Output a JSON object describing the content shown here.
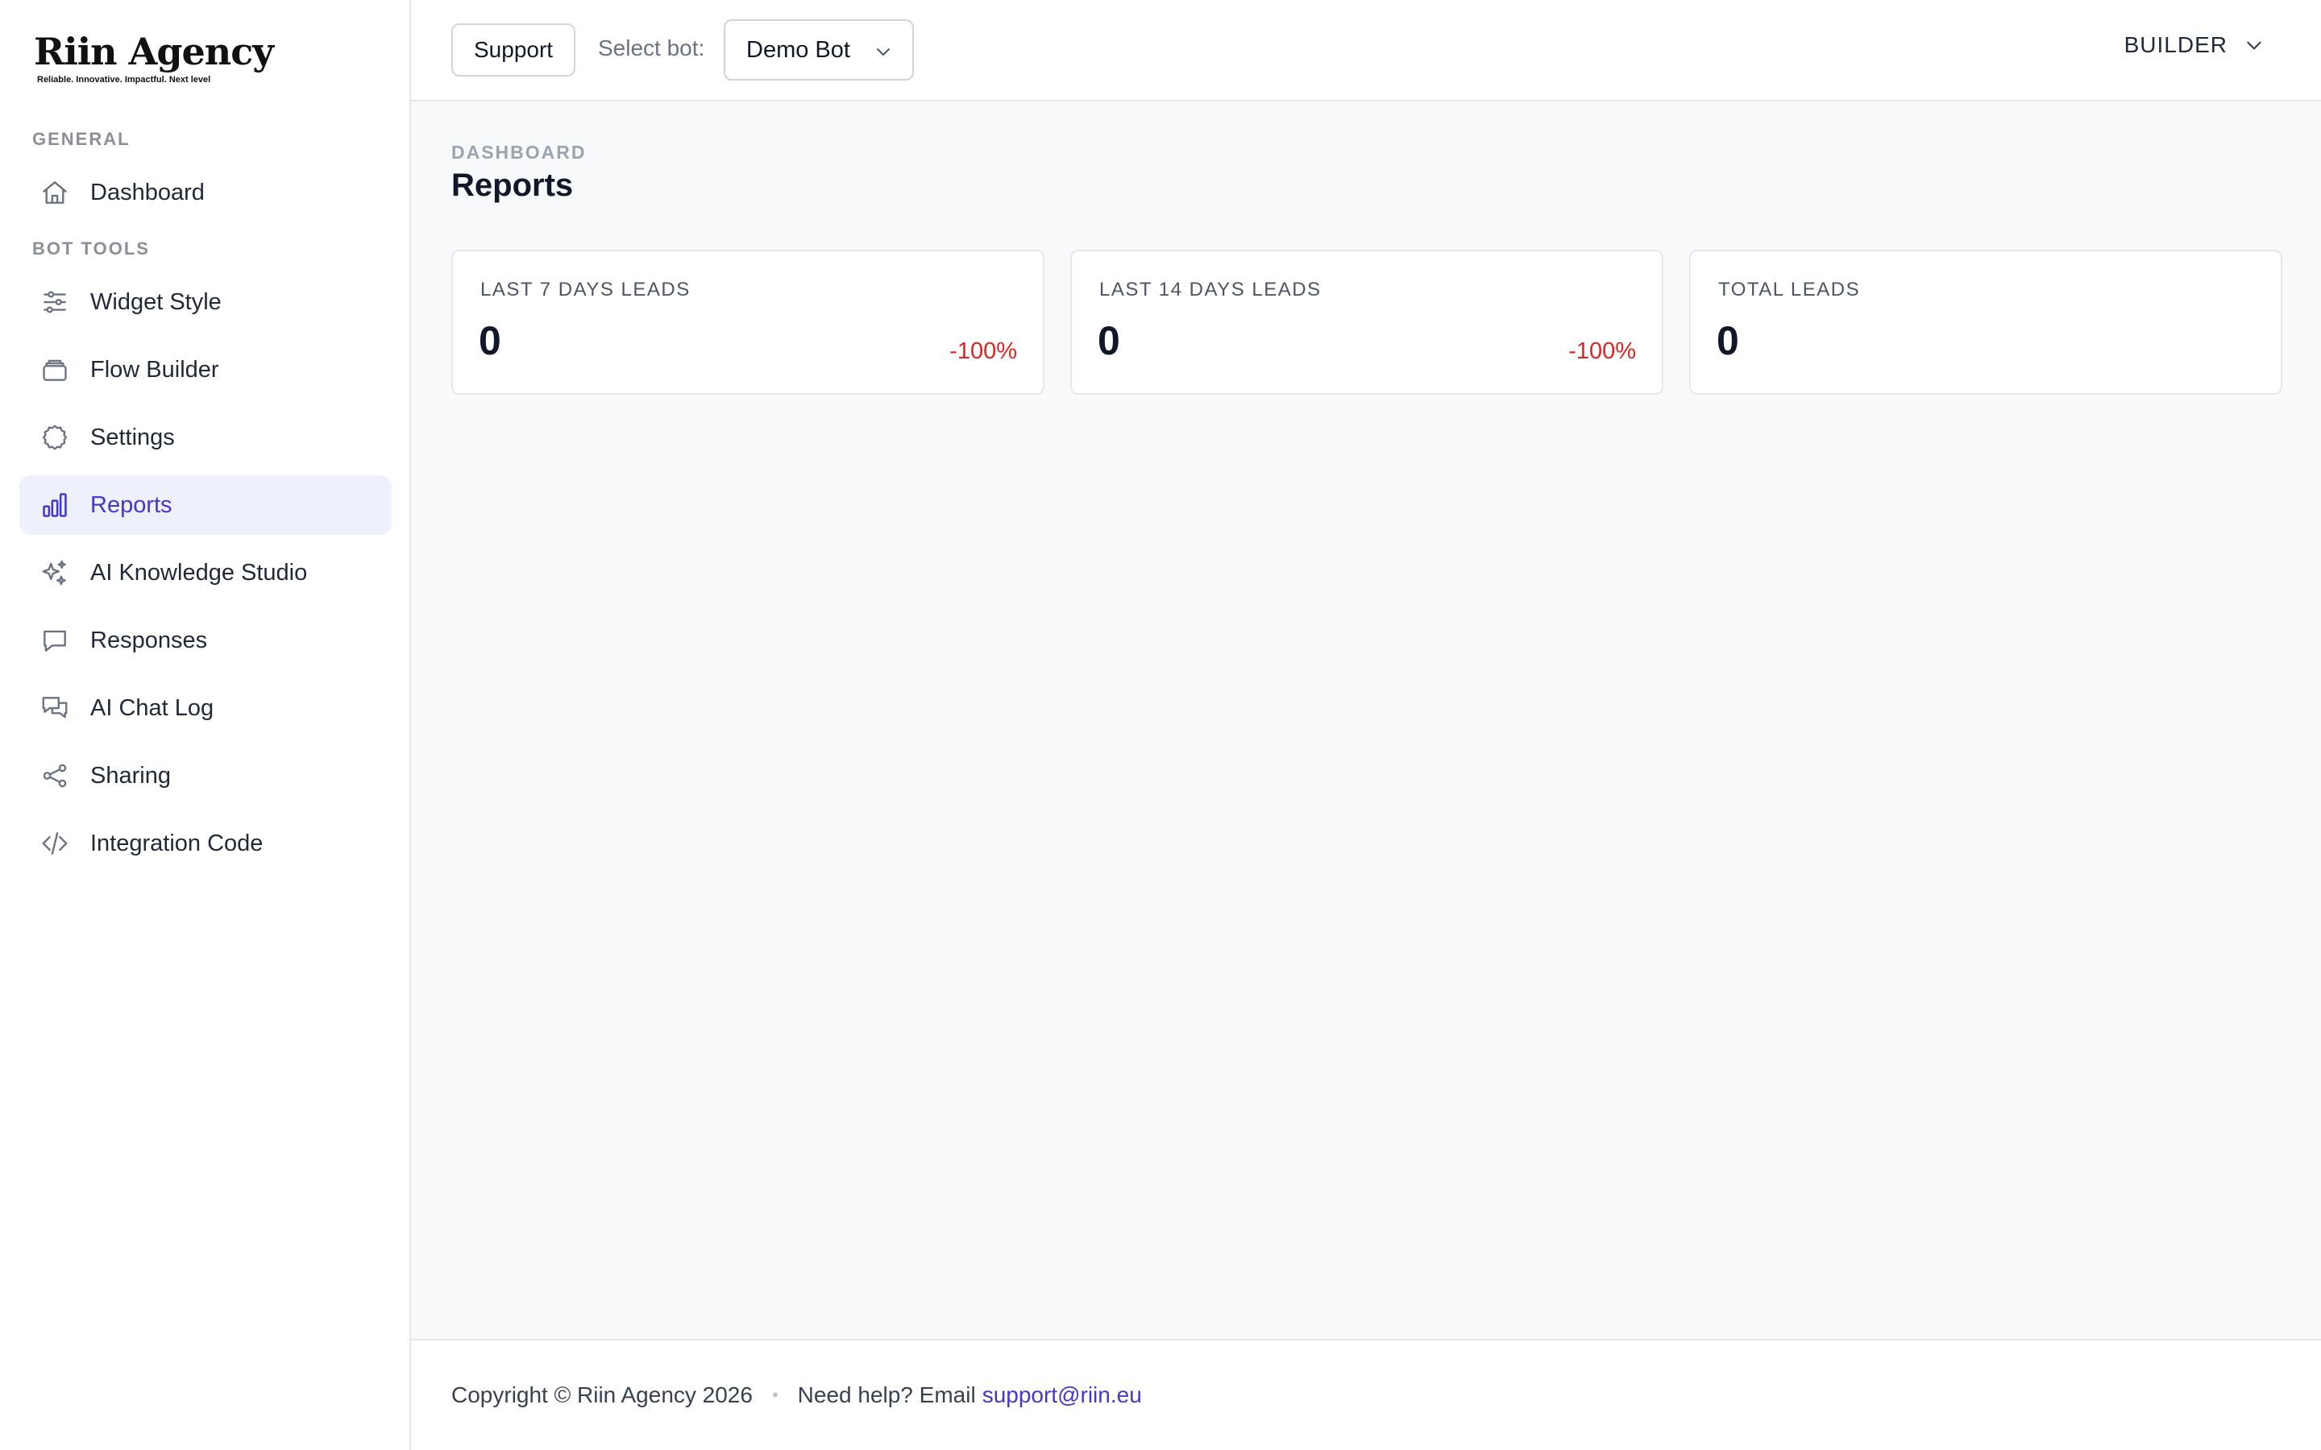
{
  "brand": {
    "name": "Riin Agency",
    "tagline": "Reliable. Innovative. Impactful. Next level"
  },
  "sidebar": {
    "sections": [
      {
        "label": "GENERAL",
        "items": [
          {
            "label": "Dashboard",
            "icon": "home-icon",
            "active": false
          }
        ]
      },
      {
        "label": "BOT TOOLS",
        "items": [
          {
            "label": "Widget Style",
            "icon": "sliders-icon",
            "active": false
          },
          {
            "label": "Flow Builder",
            "icon": "stack-icon",
            "active": false
          },
          {
            "label": "Settings",
            "icon": "gear-icon",
            "active": false
          },
          {
            "label": "Reports",
            "icon": "bar-chart-icon",
            "active": true
          },
          {
            "label": "AI Knowledge Studio",
            "icon": "sparkles-icon",
            "active": false
          },
          {
            "label": "Responses",
            "icon": "chat-bubble-icon",
            "active": false
          },
          {
            "label": "AI Chat Log",
            "icon": "chat-bubbles-icon",
            "active": false
          },
          {
            "label": "Sharing",
            "icon": "share-icon",
            "active": false
          },
          {
            "label": "Integration Code",
            "icon": "code-icon",
            "active": false
          }
        ]
      }
    ]
  },
  "topbar": {
    "support_label": "Support",
    "select_bot_label": "Select bot:",
    "selected_bot": "Demo Bot",
    "role_menu_label": "BUILDER"
  },
  "main": {
    "breadcrumb": "DASHBOARD",
    "title": "Reports",
    "cards": [
      {
        "label": "LAST 7 DAYS LEADS",
        "value": "0",
        "change": "-100%"
      },
      {
        "label": "LAST 14 DAYS LEADS",
        "value": "0",
        "change": "-100%"
      },
      {
        "label": "TOTAL LEADS",
        "value": "0",
        "change": ""
      }
    ]
  },
  "footer": {
    "copyright": "Copyright © Riin Agency 2026",
    "help_text": "Need help? Email",
    "help_email": "support@riin.eu"
  },
  "colors": {
    "accent": "#4338ca",
    "active_bg": "#eef0fc",
    "negative": "#dc2626"
  }
}
